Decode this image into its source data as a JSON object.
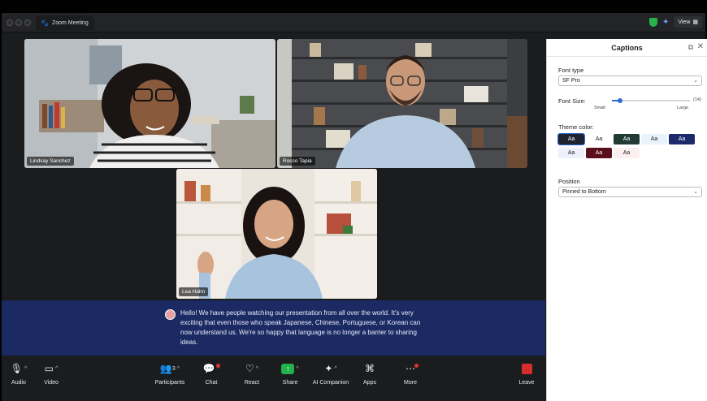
{
  "window": {
    "tab_title": "Zoom Meeting",
    "view_label": "View"
  },
  "participants": [
    {
      "name": "Lindsay Sanchez"
    },
    {
      "name": "Rocco Tapia"
    },
    {
      "name": "Lea Hahn"
    }
  ],
  "caption": {
    "text": "Hello! We have people watching our presentation from all over the world. It's very exciting that even those who speak Japanese, Chinese, Portuguese, or Korean can now understand us. We're so happy that language is no longer a barrier to sharing ideas."
  },
  "toolbar": {
    "audio": "Audio",
    "video": "Video",
    "participants": "Participants",
    "participants_count": "3",
    "chat": "Chat",
    "react": "React",
    "share": "Share",
    "ai_companion": "AI Companion",
    "apps": "Apps",
    "more": "More",
    "leave": "Leave"
  },
  "captions_panel": {
    "title": "Captions",
    "font_type_label": "Font type",
    "font_type_value": "SF Pro",
    "font_size_label": "Font Size:",
    "font_size_min": "Small",
    "font_size_max": "Large",
    "font_size_value": "(14)",
    "font_size_fraction": 0.1,
    "theme_color_label": "Theme color:",
    "theme_swatch_text": "Aa",
    "themes": [
      {
        "bg": "#1f2230",
        "fg": "#ffffff",
        "selected": true
      },
      {
        "bg": "#ffffff",
        "fg": "#222222"
      },
      {
        "bg": "#1f3b34",
        "fg": "#ffffff"
      },
      {
        "bg": "#e8f3fb",
        "fg": "#222222"
      },
      {
        "bg": "#1c2a6b",
        "fg": "#ffffff"
      },
      {
        "bg": "#eef1fb",
        "fg": "#222222"
      },
      {
        "bg": "#5b0f1c",
        "fg": "#ffffff"
      },
      {
        "bg": "#fbeff0",
        "fg": "#222222"
      }
    ],
    "position_label": "Position",
    "position_value": "Pinned to Bottom"
  }
}
